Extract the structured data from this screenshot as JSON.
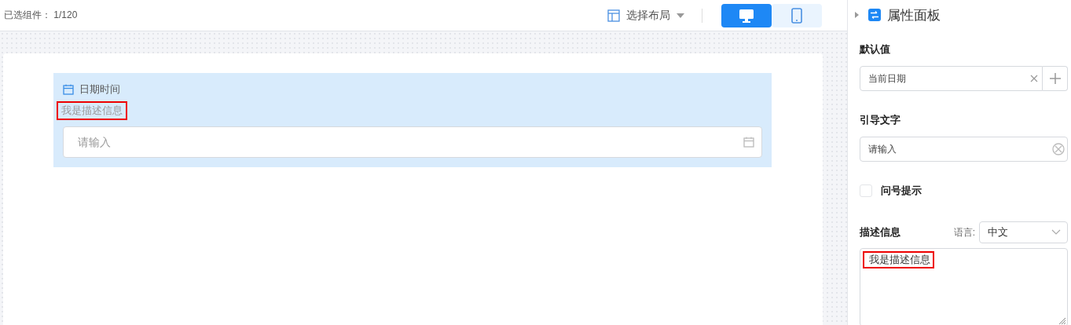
{
  "toolbar": {
    "selection_label": "已选组件：",
    "selection_count": "1/120",
    "layout_select": "选择布局",
    "view_modes": [
      {
        "kind": "desktop",
        "selected": true
      },
      {
        "kind": "mobile",
        "selected": false
      }
    ]
  },
  "canvas": {
    "field": {
      "label": "日期时间",
      "description": "我是描述信息",
      "description_highlighted": true,
      "placeholder": "请输入"
    }
  },
  "properties_panel": {
    "title": "属性面板",
    "default_value": {
      "label": "默认值",
      "value": "当前日期"
    },
    "guide_text": {
      "label": "引导文字",
      "value": "请输入"
    },
    "tooltip": {
      "label": "问号提示",
      "checked": false
    },
    "description": {
      "label": "描述信息",
      "language_label": "语言:",
      "language": "中文",
      "value": "我是描述信息",
      "highlighted": true
    }
  }
}
